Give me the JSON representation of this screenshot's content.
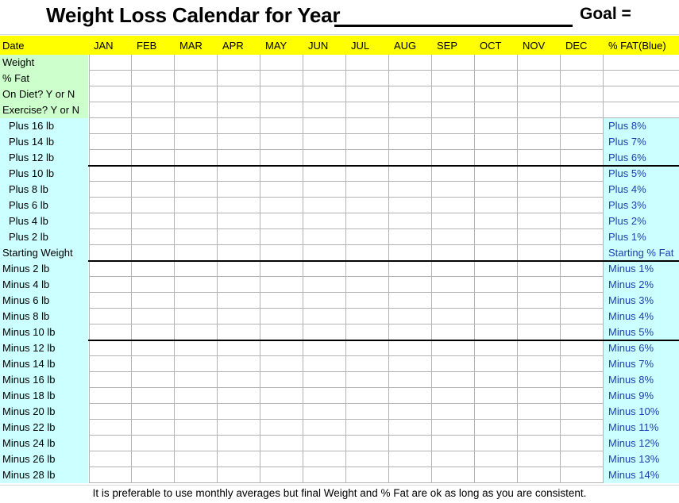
{
  "header": {
    "title": "Weight Loss Calendar for Year",
    "year_blank": "",
    "goal_label": "Goal ="
  },
  "colors": {
    "header_bg": "#ffff00",
    "label_green": "#ccffcc",
    "label_cyan": "#ccffff",
    "fat_text": "#1a3fb0",
    "grid_line": "#b3b3b3",
    "heavy_line": "#000000"
  },
  "columns": {
    "first_header": "Date",
    "months": [
      "JAN",
      "FEB",
      "MAR",
      "APR",
      "MAY",
      "JUN",
      "JUL",
      "AUG",
      "SEP",
      "OCT",
      "NOV",
      "DEC"
    ],
    "last_header": "% FAT(Blue)"
  },
  "rows": [
    {
      "label": "Weight",
      "label_bg": "green",
      "indent": false,
      "fat": "",
      "fat_bg": "white",
      "heavy_below": false
    },
    {
      "label": "% Fat",
      "label_bg": "green",
      "indent": false,
      "fat": "",
      "fat_bg": "white",
      "heavy_below": false
    },
    {
      "label": "On Diet? Y or N",
      "label_bg": "green",
      "indent": false,
      "fat": "",
      "fat_bg": "white",
      "heavy_below": false
    },
    {
      "label": "Exercise? Y or N",
      "label_bg": "green",
      "indent": false,
      "fat": "",
      "fat_bg": "white",
      "heavy_below": false
    },
    {
      "label": "Plus 16 lb",
      "label_bg": "cyan",
      "indent": true,
      "fat": "Plus 8%",
      "fat_bg": "cyan",
      "heavy_below": false
    },
    {
      "label": "Plus 14 lb",
      "label_bg": "cyan",
      "indent": true,
      "fat": "Plus 7%",
      "fat_bg": "cyan",
      "heavy_below": false
    },
    {
      "label": "Plus 12 lb",
      "label_bg": "cyan",
      "indent": true,
      "fat": "Plus 6%",
      "fat_bg": "cyan",
      "heavy_below": true
    },
    {
      "label": "Plus 10 lb",
      "label_bg": "cyan",
      "indent": true,
      "fat": "Plus 5%",
      "fat_bg": "cyan",
      "heavy_below": false
    },
    {
      "label": "Plus 8 lb",
      "label_bg": "cyan",
      "indent": true,
      "fat": "Plus 4%",
      "fat_bg": "cyan",
      "heavy_below": false
    },
    {
      "label": "Plus 6 lb",
      "label_bg": "cyan",
      "indent": true,
      "fat": "Plus 3%",
      "fat_bg": "cyan",
      "heavy_below": false
    },
    {
      "label": "Plus 4 lb",
      "label_bg": "cyan",
      "indent": true,
      "fat": "Plus 2%",
      "fat_bg": "cyan",
      "heavy_below": false
    },
    {
      "label": "Plus 2 lb",
      "label_bg": "cyan",
      "indent": true,
      "fat": "Plus 1%",
      "fat_bg": "cyan",
      "heavy_below": false
    },
    {
      "label": "Starting Weight",
      "label_bg": "cyan",
      "indent": false,
      "fat": "Starting % Fat",
      "fat_bg": "cyan",
      "heavy_below": true
    },
    {
      "label": "Minus 2 lb",
      "label_bg": "cyan",
      "indent": false,
      "fat": "Minus 1%",
      "fat_bg": "cyan",
      "heavy_below": false
    },
    {
      "label": "Minus 4 lb",
      "label_bg": "cyan",
      "indent": false,
      "fat": "Minus 2%",
      "fat_bg": "cyan",
      "heavy_below": false
    },
    {
      "label": "Minus 6 lb",
      "label_bg": "cyan",
      "indent": false,
      "fat": "Minus 3%",
      "fat_bg": "cyan",
      "heavy_below": false
    },
    {
      "label": "Minus 8 lb",
      "label_bg": "cyan",
      "indent": false,
      "fat": "Minus 4%",
      "fat_bg": "cyan",
      "heavy_below": false
    },
    {
      "label": "Minus 10 lb",
      "label_bg": "cyan",
      "indent": false,
      "fat": "Minus 5%",
      "fat_bg": "cyan",
      "heavy_below": true
    },
    {
      "label": "Minus 12 lb",
      "label_bg": "cyan",
      "indent": false,
      "fat": "Minus 6%",
      "fat_bg": "cyan",
      "heavy_below": false
    },
    {
      "label": "Minus 14 lb",
      "label_bg": "cyan",
      "indent": false,
      "fat": "Minus 7%",
      "fat_bg": "cyan",
      "heavy_below": false
    },
    {
      "label": "Minus 16 lb",
      "label_bg": "cyan",
      "indent": false,
      "fat": "Minus 8%",
      "fat_bg": "cyan",
      "heavy_below": false
    },
    {
      "label": "Minus 18 lb",
      "label_bg": "cyan",
      "indent": false,
      "fat": "Minus 9%",
      "fat_bg": "cyan",
      "heavy_below": false
    },
    {
      "label": "Minus 20 lb",
      "label_bg": "cyan",
      "indent": false,
      "fat": "Minus 10%",
      "fat_bg": "cyan",
      "heavy_below": false
    },
    {
      "label": "Minus 22 lb",
      "label_bg": "cyan",
      "indent": false,
      "fat": "Minus 11%",
      "fat_bg": "cyan",
      "heavy_below": false
    },
    {
      "label": "Minus 24 lb",
      "label_bg": "cyan",
      "indent": false,
      "fat": "Minus 12%",
      "fat_bg": "cyan",
      "heavy_below": false
    },
    {
      "label": "Minus 26 lb",
      "label_bg": "cyan",
      "indent": false,
      "fat": "Minus 13%",
      "fat_bg": "cyan",
      "heavy_below": false
    },
    {
      "label": "Minus 28 lb",
      "label_bg": "cyan",
      "indent": false,
      "fat": "Minus 14%",
      "fat_bg": "cyan",
      "heavy_below": false
    }
  ],
  "footer": {
    "note": "It is preferable to use monthly averages but final Weight and % Fat are ok as long as you are consistent."
  }
}
